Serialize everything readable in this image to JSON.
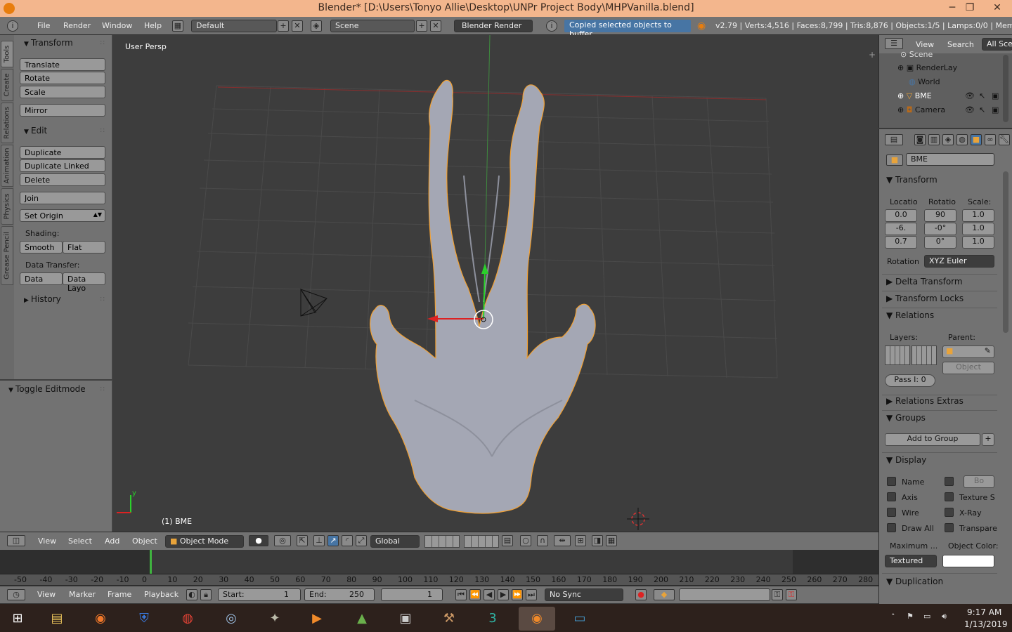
{
  "window": {
    "title": "Blender* [D:\\Users\\Tonyo Allie\\Desktop\\UNPr Project Body\\MHPVanilla.blend]",
    "min": "─",
    "max": "❐",
    "close": "✕"
  },
  "info": {
    "menus": [
      "File",
      "Render",
      "Window",
      "Help"
    ],
    "layout": "Default",
    "scene": "Scene",
    "engine": "Blender Render",
    "message": "Copied selected objects to buffer",
    "status": "v2.79 | Verts:4,516 | Faces:8,799 | Tris:8,876 | Objects:1/5 | Lamps:0/0 | Mem:14.6"
  },
  "tool_tabs": [
    "Tools",
    "Create",
    "Relations",
    "Animation",
    "Physics",
    "Grease Pencil"
  ],
  "tools": {
    "transform_header": "Transform",
    "translate": "Translate",
    "rotate": "Rotate",
    "scale": "Scale",
    "mirror": "Mirror",
    "edit_header": "Edit",
    "duplicate": "Duplicate",
    "duplicate_linked": "Duplicate Linked",
    "delete": "Delete",
    "join": "Join",
    "set_origin": "Set Origin",
    "shading_label": "Shading:",
    "smooth": "Smooth",
    "flat": "Flat",
    "data_transfer_label": "Data Transfer:",
    "data": "Data",
    "data_layo": "Data Layo",
    "history": "History"
  },
  "last_op": {
    "header": "Toggle Editmode"
  },
  "viewport": {
    "view_name": "User Persp",
    "object_label": "(1) BME"
  },
  "v3d_header": {
    "view": "View",
    "select": "Select",
    "add": "Add",
    "object": "Object",
    "mode": "Object Mode",
    "orientation": "Global"
  },
  "timeline": {
    "ticks": [
      "-50",
      "-40",
      "-30",
      "-20",
      "-10",
      "0",
      "10",
      "20",
      "30",
      "40",
      "50",
      "60",
      "70",
      "80",
      "90",
      "100",
      "110",
      "120",
      "130",
      "140",
      "150",
      "160",
      "170",
      "180",
      "190",
      "200",
      "210",
      "220",
      "230",
      "240",
      "250",
      "260",
      "270",
      "280"
    ],
    "current_frame_marker": 0
  },
  "tl_header": {
    "view": "View",
    "marker": "Marker",
    "frame": "Frame",
    "playback": "Playback",
    "start_label": "Start:",
    "start": "1",
    "end_label": "End:",
    "end": "250",
    "current": "1",
    "sync": "No Sync"
  },
  "outliner": {
    "view": "View",
    "search": "Search",
    "filter": "All Sce",
    "items": [
      "Scene",
      "RenderLay",
      "World",
      "BME",
      "Camera"
    ]
  },
  "props": {
    "object_name": "BME",
    "transform": "Transform",
    "location_label": "Locatio",
    "rotation_label": "Rotatio",
    "scale_label": "Scale:",
    "loc": [
      "0.0",
      "-6.",
      "0.7"
    ],
    "rot": [
      "90",
      "-0°",
      "0°"
    ],
    "scale": [
      "1.0",
      "1.0",
      "1.0"
    ],
    "rotation_mode_label": "Rotation",
    "rotation_mode": "XYZ Euler",
    "delta": "Delta Transform",
    "locks": "Transform Locks",
    "relations": "Relations",
    "layers_label": "Layers:",
    "parent_label": "Parent:",
    "parent_type": "Object",
    "pass_index": "Pass I:  0",
    "relations_extras": "Relations Extras",
    "groups": "Groups",
    "add_to_group": "Add to Group",
    "display": "Display",
    "name": "Name",
    "bo": "Bo",
    "axis": "Axis",
    "texture": "Texture S",
    "wire": "Wire",
    "xray": "X-Ray",
    "draw_all": "Draw All",
    "transparent": "Transpare",
    "maximum": "Maximum ...",
    "object_color": "Object Color:",
    "max_value": "Textured",
    "duplication": "Duplication"
  },
  "taskbar": {
    "time": "9:17 AM",
    "date": "1/13/2019"
  },
  "colors": {
    "accent": "#4775a4",
    "selection": "#f2a133",
    "title_bg": "#f3b68d"
  }
}
